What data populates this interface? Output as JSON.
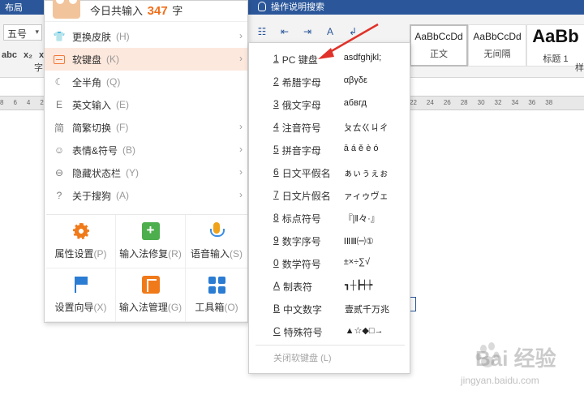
{
  "word": {
    "layout_tab": "布局",
    "tell_me": "操作说明搜索",
    "font_size": "五号",
    "format_buttons": [
      "abc",
      "x₂",
      "x²"
    ],
    "font_group_label": "字",
    "styles_group_label": "样",
    "styles": [
      {
        "sample": "AaBbCcDd",
        "name": "正文"
      },
      {
        "sample": "AaBbCcDd",
        "name": "无间隔"
      },
      {
        "sample": "AaBb",
        "name": "标题 1"
      }
    ],
    "ruler_left": [
      "8",
      "6",
      "4",
      "2"
    ],
    "ruler_right": [
      "22",
      "24",
      "26",
      "28",
      "30",
      "32",
      "34",
      "36",
      "38"
    ]
  },
  "sogou_menu": {
    "header_prefix": "今日共输入",
    "header_count": "347",
    "header_suffix": "字",
    "items": [
      {
        "label": "更换皮肤",
        "shortcut": "(H)",
        "icon": "shirt-icon",
        "glyph": "👕",
        "submenu": true
      },
      {
        "label": "软键盘",
        "shortcut": "(K)",
        "icon": "keyboard-icon",
        "glyph": "",
        "submenu": true,
        "highlighted": true
      },
      {
        "label": "全半角",
        "shortcut": "(Q)",
        "icon": "moon-icon",
        "glyph": "☾",
        "submenu": false
      },
      {
        "label": "英文输入",
        "shortcut": "(E)",
        "icon": "english-icon",
        "glyph": "E",
        "submenu": false
      },
      {
        "label": "简繁切换",
        "shortcut": "(F)",
        "icon": "jian-icon",
        "glyph": "简",
        "submenu": true
      },
      {
        "label": "表情&符号",
        "shortcut": "(B)",
        "icon": "smiley-icon",
        "glyph": "☺",
        "submenu": true
      },
      {
        "label": "隐藏状态栏",
        "shortcut": "(Y)",
        "icon": "statusbar-icon",
        "glyph": "⊖",
        "submenu": true
      },
      {
        "label": "关于搜狗",
        "shortcut": "(A)",
        "icon": "help-icon",
        "glyph": "?",
        "submenu": true
      }
    ],
    "grid": [
      {
        "label": "属性设置",
        "shortcut": "(P)",
        "icon": "gear-icon",
        "cls": "gear"
      },
      {
        "label": "输入法修复",
        "shortcut": "(R)",
        "icon": "repair-icon",
        "cls": "repair"
      },
      {
        "label": "语音输入",
        "shortcut": "(S)",
        "icon": "microphone-icon",
        "cls": "mic"
      },
      {
        "label": "设置向导",
        "shortcut": "(X)",
        "icon": "flag-icon",
        "cls": "flag"
      },
      {
        "label": "输入法管理",
        "shortcut": "(G)",
        "icon": "manage-icon",
        "cls": "manage"
      },
      {
        "label": "工具箱",
        "shortcut": "(O)",
        "icon": "toolbox-icon",
        "cls": "tools"
      }
    ]
  },
  "softkeyboard_menu": {
    "items": [
      {
        "key": "1",
        "label": "PC 键盘",
        "example": "asdfghjkl;"
      },
      {
        "key": "2",
        "label": "希腊字母",
        "example": "αβγδε"
      },
      {
        "key": "3",
        "label": "俄文字母",
        "example": "абвгд"
      },
      {
        "key": "4",
        "label": "注音符号",
        "example": "ㄆㄊㄍㄐㄔ"
      },
      {
        "key": "5",
        "label": "拼音字母",
        "example": "ā á ě è ó"
      },
      {
        "key": "6",
        "label": "日文平假名",
        "example": "ぁぃぅぇぉ"
      },
      {
        "key": "7",
        "label": "日文片假名",
        "example": "ァィゥヴェ"
      },
      {
        "key": "8",
        "label": "标点符号",
        "example": "『|‖々·』"
      },
      {
        "key": "9",
        "label": "数字序号",
        "example": "ⅠⅡⅢ㈠①"
      },
      {
        "key": "0",
        "label": "数学符号",
        "example": "±×÷∑√"
      },
      {
        "key": "A",
        "label": "制表符",
        "example": "┓┼┣┽┾"
      },
      {
        "key": "B",
        "label": "中文数字",
        "example": "壹贰千万兆"
      },
      {
        "key": "C",
        "label": "特殊符号",
        "example": "▲☆◆□→"
      }
    ],
    "close_label": "关闭软键盘",
    "close_shortcut": "(L)"
  },
  "watermark": {
    "brand": "Bai 经验",
    "url": "jingyan.baidu.com"
  },
  "colors": {
    "word_blue": "#2b579a",
    "highlight": "#fde8dd",
    "accent_orange": "#f06f1a",
    "arrow_red": "#e0322a"
  }
}
